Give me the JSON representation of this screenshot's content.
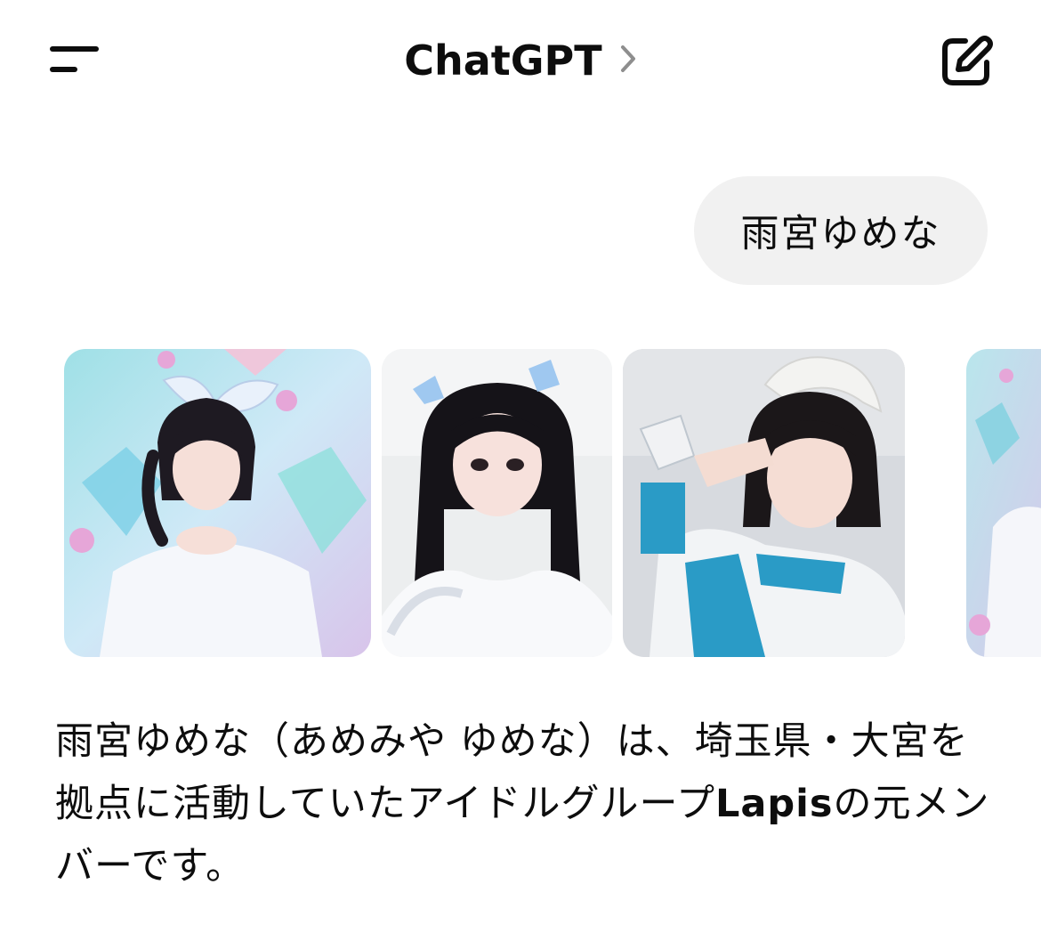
{
  "header": {
    "title": "ChatGPT",
    "menu_icon": "hamburger-menu-icon",
    "title_icon": "chevron-right-icon",
    "new_chat_icon": "new-chat-edit-icon"
  },
  "conversation": {
    "user_message": "雨宮ゆめな",
    "image_results": [
      {
        "desc": "idol-photo-crystal-hearts-background"
      },
      {
        "desc": "idol-photo-twin-tails-blue-bows"
      },
      {
        "desc": "idol-photo-maid-headband-salute"
      },
      {
        "desc": "idol-photo-partial"
      }
    ],
    "assistant_text_part1": "雨宮ゆめな（あめみや ゆめな）は、埼玉県・大宮を拠点に活動していたアイドルグループ",
    "assistant_text_bold": "Lapis",
    "assistant_text_part2": "の元メンバーです。"
  },
  "colors": {
    "text": "#0d0d0d",
    "bubble": "#f1f1f1",
    "chevron": "#8e8e8e"
  }
}
